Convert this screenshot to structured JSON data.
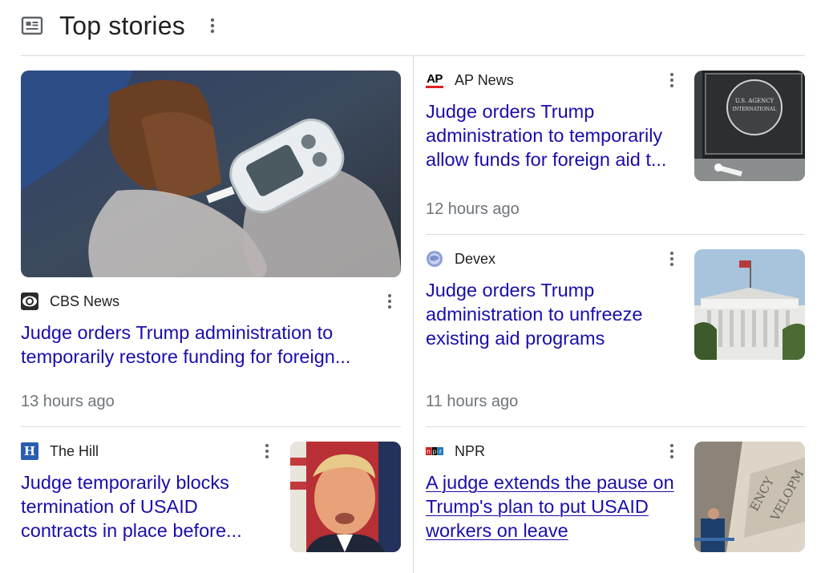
{
  "section": {
    "title": "Top stories",
    "icon": "newspaper-icon"
  },
  "stories": [
    {
      "source": "CBS News",
      "headline": "Judge orders Trump administration to temporarily restore funding for foreign...",
      "time": "13 hours ago",
      "logo": "cbs-eye-icon",
      "image": "glucose-meter-photo"
    },
    {
      "source": "AP News",
      "headline": "Judge orders Trump administration to temporarily allow funds for foreign aid t...",
      "time": "12 hours ago",
      "logo_text": "AP",
      "image": "usaid-sign-photo"
    },
    {
      "source": "Devex",
      "headline": "Judge orders Trump administration to unfreeze existing aid programs",
      "time": "11 hours ago",
      "logo": "devex-globe-icon",
      "image": "white-house-photo"
    },
    {
      "source": "The Hill",
      "headline": "Judge temporarily blocks termination of USAID contracts in place before...",
      "logo_text": "H",
      "image": "trump-portrait-photo"
    },
    {
      "source": "NPR",
      "headline": "A judge extends the pause on Trump's plan to put USAID workers on leave",
      "logo_text": "npr",
      "image": "building-sign-photo"
    }
  ],
  "colors": {
    "headline": "#1a0dab",
    "meta": "#70757a",
    "divider": "#dadce0"
  }
}
